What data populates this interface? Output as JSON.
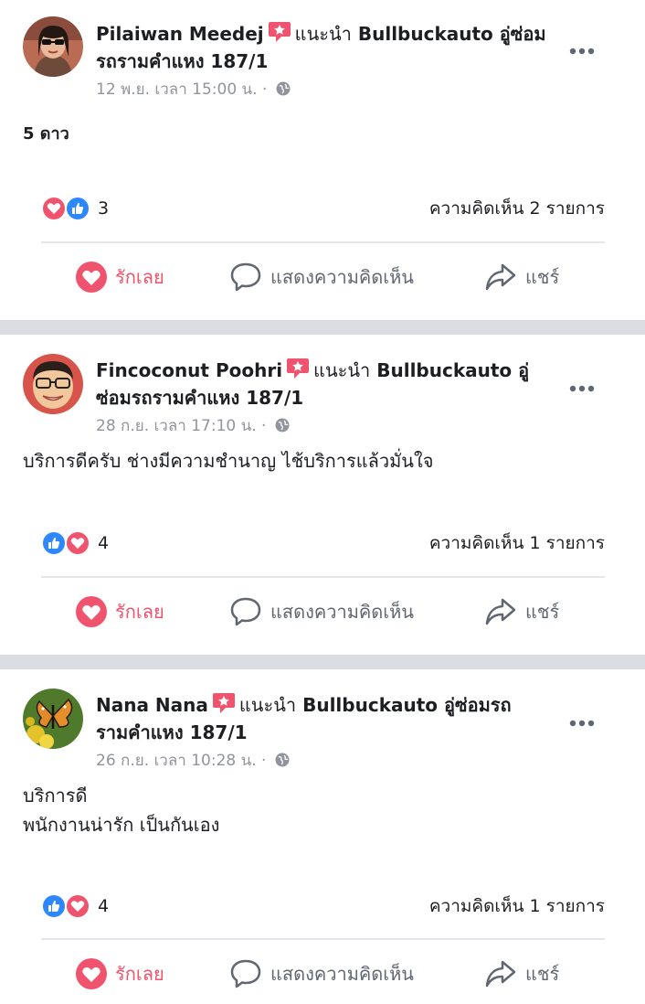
{
  "colors": {
    "like_blue": "#2d88ff",
    "love_red": "#f0536d",
    "text_dark": "#1c1e21",
    "meta_grey": "#90949c",
    "action_grey": "#606770",
    "divider": "#dadde1"
  },
  "posts": [
    {
      "author": "Pilaiwan Meedej",
      "verb": "แนะนำ",
      "target_line1": "Bullbuckauto อู่ซ่อม",
      "target_line2": "รถรามคำแหง 187/1",
      "time": "12 พ.ย. เวลา 15:00 น. ·",
      "text": "5 ดาว",
      "reaction_count": "3",
      "reaction_order": [
        "love",
        "like"
      ],
      "comments": "ความคิดเห็น 2 รายการ",
      "avatar_icon": "woman-sunglasses-avatar"
    },
    {
      "author": "Fincoconut Poohri",
      "verb": "แนะนำ",
      "target_line1": "Bullbuckauto อู่",
      "target_line2": "ซ่อมรถรามคำแหง 187/1",
      "time": "28 ก.ย. เวลา 17:10 น. ·",
      "text": "บริการดีครับ ช่างมีความชำนาญ ไช้บริการแล้วมั่นใจ",
      "reaction_count": "4",
      "reaction_order": [
        "like",
        "love"
      ],
      "comments": "ความคิดเห็น 1 รายการ",
      "avatar_icon": "man-glasses-avatar"
    },
    {
      "author": "Nana Nana",
      "verb": "แนะนำ",
      "target_line1": "Bullbuckauto อู่ซ่อมรถ",
      "target_line2": "รามคำแหง 187/1",
      "time": "26 ก.ย. เวลา 10:28 น. ·",
      "text": "บริการดี\nพนักงานน่ารัก เป็นกันเอง",
      "reaction_count": "4",
      "reaction_order": [
        "like",
        "love"
      ],
      "comments": "ความคิดเห็น 1 รายการ",
      "avatar_icon": "butterfly-avatar"
    }
  ],
  "actions": {
    "love": "รักเลย",
    "comment": "แสดงความคิดเห็น",
    "share": "แชร์"
  }
}
